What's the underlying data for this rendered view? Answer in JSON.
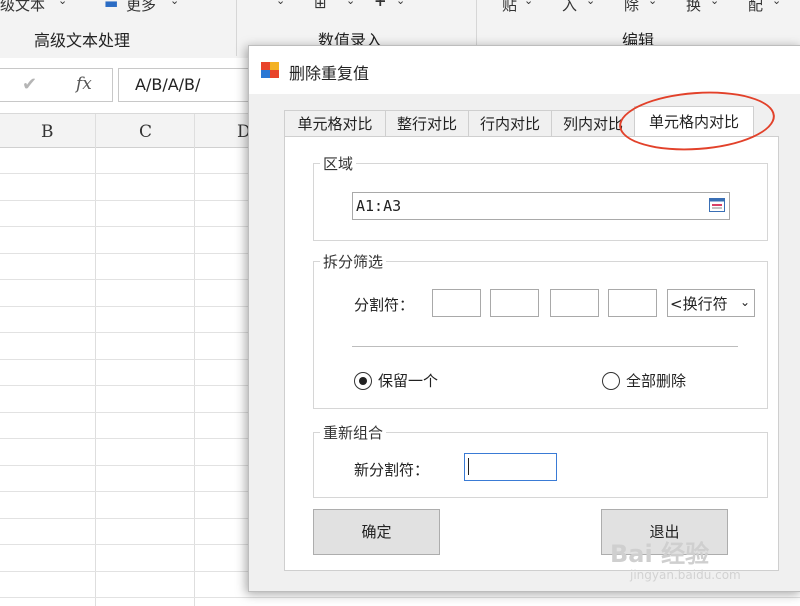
{
  "ribbon": {
    "items": [
      "级文本",
      "更多",
      "贴",
      "入",
      "除",
      "换",
      "配"
    ],
    "groups": [
      "高级文本处理",
      "数值录入",
      "编辑"
    ]
  },
  "formula_bar": {
    "fx_label": "fx",
    "content": "A/B/A/B/"
  },
  "columns": [
    "B",
    "C",
    "D"
  ],
  "dialog": {
    "title": "删除重复值",
    "tabs": [
      "单元格对比",
      "整行对比",
      "行内对比",
      "列内对比",
      "单元格内对比"
    ],
    "active_tab_index": 4,
    "region": {
      "label": "区域",
      "value": "A1:A3"
    },
    "split_filter": {
      "label": "拆分筛选",
      "delimiter_label": "分割符：",
      "delimiter_select": "<换行符",
      "options": [
        {
          "label": "保留一个",
          "selected": true
        },
        {
          "label": "全部删除",
          "selected": false
        }
      ]
    },
    "regroup": {
      "label": "重新组合",
      "new_delimiter_label": "新分割符：",
      "new_delimiter_value": ""
    },
    "buttons": {
      "ok": "确定",
      "exit": "退出"
    }
  },
  "watermark": {
    "text": "Bai 经验",
    "sub": "jingyan.baidu.com"
  },
  "colors": {
    "highlight": "#e2412a",
    "dialog_bg": "#f0f0f0"
  }
}
